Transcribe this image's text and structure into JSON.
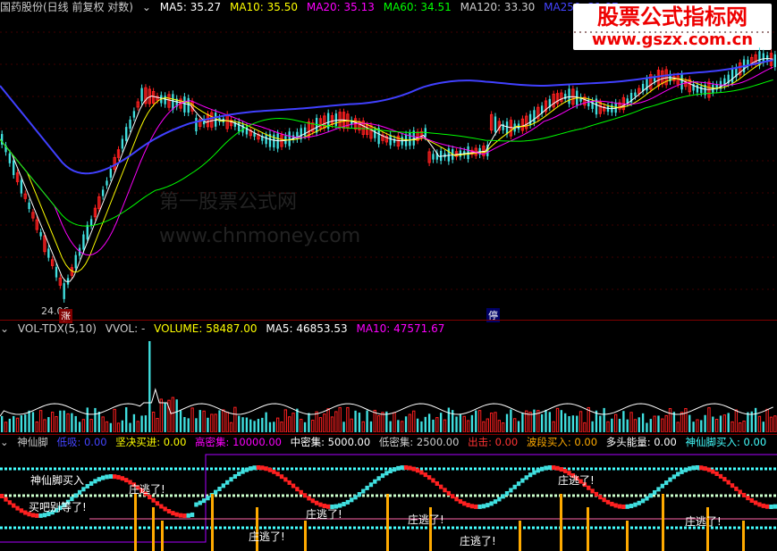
{
  "header": {
    "stock_title": "国药股份(日线 前复权 对数)",
    "ma5": "MA5: 35.27",
    "ma10": "MA10: 35.50",
    "ma20": "MA20: 35.13",
    "ma60": "MA60: 34.51",
    "ma120": "MA120: 33.30",
    "ma250": "MA250: 31.87"
  },
  "logo": {
    "line1": "股票公式指标网",
    "line2": "www.gszx.com.cn"
  },
  "watermark": {
    "line1": "第一股票公式网",
    "line2": "www.chnmoney.com"
  },
  "price_panel": {
    "low_label": "24.06",
    "up_tag": "涨",
    "stop_tag": "停"
  },
  "volume_header": {
    "name": "VOL-TDX(5,10)",
    "vvol": "VVOL: -",
    "volume": "VOLUME: 58487.00",
    "ma5": "MA5: 46853.53",
    "ma10": "MA10: 47571.67"
  },
  "indicator_header": {
    "name": "神仙脚",
    "low_suck": "低吸: 0.00",
    "decisive_buy": "坚决买进: 0.00",
    "high_dense": "高密集: 10000.00",
    "mid_dense": "中密集: 5000.00",
    "low_dense": "低密集: 2500.00",
    "sell": "出击: 0.00",
    "band_buy": "波段买入: 0.00",
    "bull_energy": "多头能量: 0.00",
    "shenxian_buy": "神仙脚买入: 0.00"
  },
  "indicator_labels": {
    "buy_label": "神仙脚买入",
    "wait_label": "买吧别等了!",
    "escape1": "庄逃了!",
    "escape2": "庄逃了!",
    "escape3": "庄逃了!",
    "escape4": "庄逃了!",
    "escape5": "庄逃了!",
    "escape6": "庄逃了!",
    "escape7": "庄逃了!"
  },
  "colors": {
    "up": "#ff2020",
    "down": "#40e0e0",
    "ma5": "#ffffff",
    "ma10": "#ffff00",
    "ma20": "#ff00ff",
    "ma60": "#00ff00",
    "ma120": "#c0c0c0",
    "ma250": "#4040ff"
  }
}
